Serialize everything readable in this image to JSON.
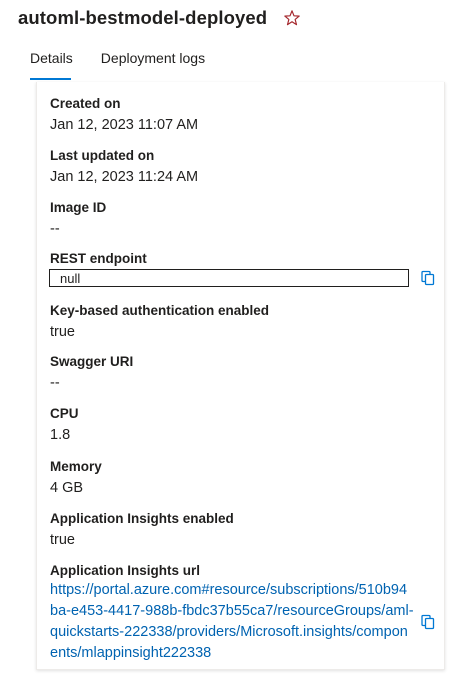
{
  "header": {
    "title": "automl-bestmodel-deployed",
    "star_icon": "star-outline-icon"
  },
  "tabs": [
    {
      "label": "Details",
      "active": true
    },
    {
      "label": "Deployment logs",
      "active": false
    }
  ],
  "details": {
    "created_on": {
      "label": "Created on",
      "value": "Jan 12, 2023 11:07 AM"
    },
    "last_updated_on": {
      "label": "Last updated on",
      "value": "Jan 12, 2023 11:24 AM"
    },
    "image_id": {
      "label": "Image ID",
      "value": "--"
    },
    "rest_endpoint": {
      "label": "REST endpoint",
      "value": "null"
    },
    "key_auth": {
      "label": "Key-based authentication enabled",
      "value": "true"
    },
    "swagger_uri": {
      "label": "Swagger URI",
      "value": "--"
    },
    "cpu": {
      "label": "CPU",
      "value": "1.8"
    },
    "memory": {
      "label": "Memory",
      "value": "4 GB"
    },
    "app_insights_enabled": {
      "label": "Application Insights enabled",
      "value": "true"
    },
    "app_insights_url": {
      "label": "Application Insights url",
      "value": "https://portal.azure.com#resource/subscriptions/510b94ba-e453-4417-988b-fbdc37b55ca7/resourceGroups/aml-quickstarts-222338/providers/Microsoft.insights/components/mlappinsight222338"
    }
  },
  "colors": {
    "accent": "#0078d4",
    "link": "#0063b1",
    "star": "#a4262c"
  }
}
